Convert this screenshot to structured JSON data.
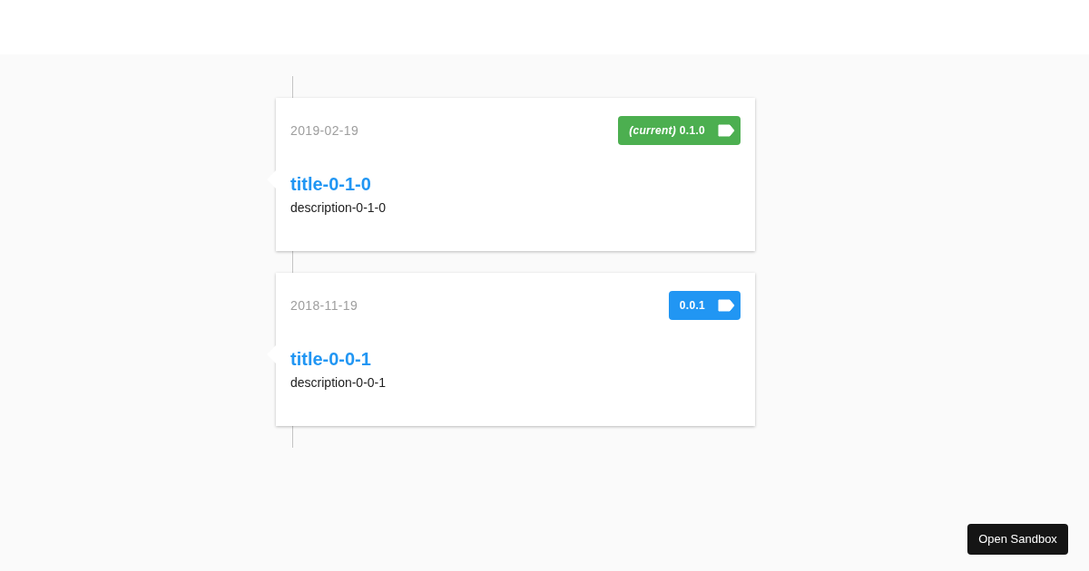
{
  "entries": [
    {
      "date": "2019-02-19",
      "badge": {
        "text": "*(current)* 0.1.0",
        "color": "#4caf50"
      },
      "title": "title-0-1-0",
      "description": "description-0-1-0"
    },
    {
      "date": "2018-11-19",
      "badge": {
        "text": "0.0.1",
        "color": "#2196f3"
      },
      "title": "title-0-0-1",
      "description": "description-0-0-1"
    }
  ],
  "open_sandbox_button": "Open Sandbox"
}
